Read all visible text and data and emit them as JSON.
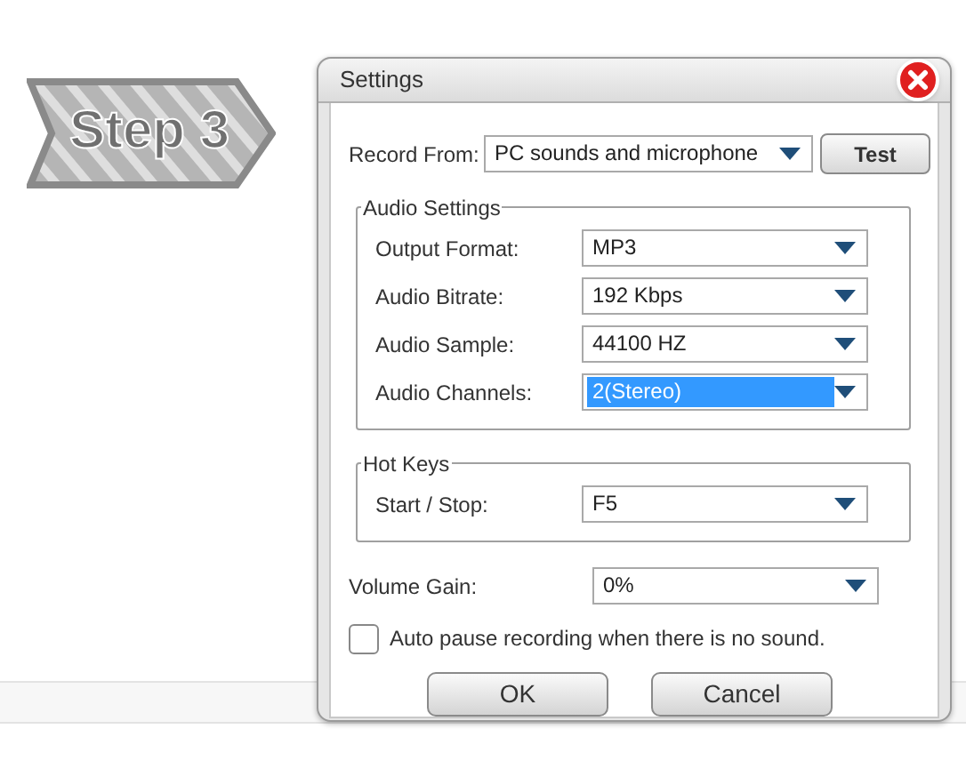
{
  "step_badge": {
    "label": "Step 3"
  },
  "window": {
    "title": "Settings"
  },
  "record_from": {
    "label": "Record From:",
    "value": "PC sounds and microphone",
    "button": "Test"
  },
  "audio_settings": {
    "title": "Audio Settings",
    "fields": [
      {
        "label": "Output Format:",
        "value": "MP3",
        "selected": false
      },
      {
        "label": "Audio Bitrate:",
        "value": "192 Kbps",
        "selected": false
      },
      {
        "label": "Audio Sample:",
        "value": "44100 HZ",
        "selected": false
      },
      {
        "label": "Audio Channels:",
        "value": "2(Stereo)",
        "selected": true
      }
    ]
  },
  "hot_keys": {
    "title": "Hot Keys",
    "fields": [
      {
        "label": "Start / Stop:",
        "value": "F5",
        "selected": false
      }
    ]
  },
  "volume_gain": {
    "label": "Volume Gain:",
    "value": "0%"
  },
  "auto_pause": {
    "label": "Auto pause recording when there is no sound.",
    "checked": false
  },
  "buttons": [
    "OK",
    "Cancel"
  ]
}
